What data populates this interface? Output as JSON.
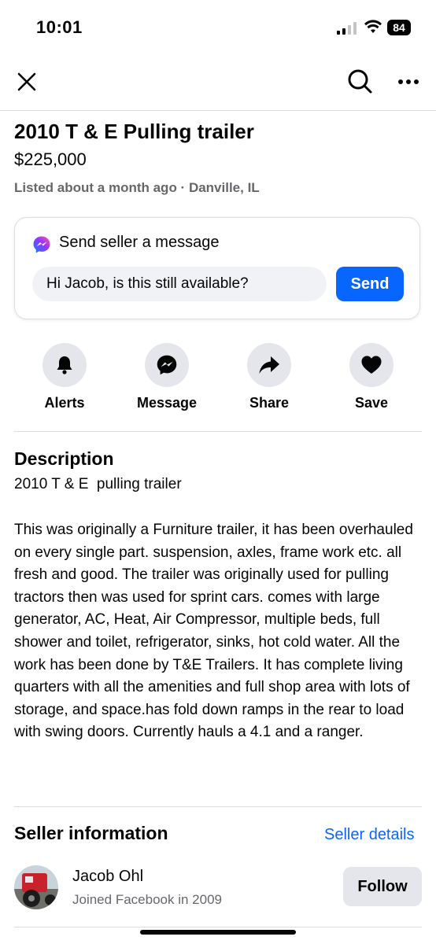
{
  "status_bar": {
    "time": "10:01",
    "battery": "84",
    "icons": [
      "signal-icon",
      "wifi-icon",
      "battery-icon"
    ]
  },
  "nav": {
    "icons": [
      "close-icon",
      "search-icon",
      "more-icon"
    ]
  },
  "listing": {
    "title": "2010 T & E Pulling trailer",
    "price": "$225,000",
    "meta": "Listed about a month ago · Danville, IL"
  },
  "message_card": {
    "heading": "Send seller a message",
    "input_value": "Hi Jacob, is this still available?",
    "send_label": "Send",
    "icon": "messenger-icon"
  },
  "actions": [
    {
      "label": "Alerts",
      "icon": "bell-icon"
    },
    {
      "label": "Message",
      "icon": "messenger-icon"
    },
    {
      "label": "Share",
      "icon": "share-icon"
    },
    {
      "label": "Save",
      "icon": "heart-icon"
    }
  ],
  "description": {
    "heading": "Description",
    "subtitle": "2010 T & E  pulling trailer",
    "body": "This was originally a Furniture trailer, it has been overhauled on every single part. suspension, axles, frame work etc. all fresh and good. The trailer was originally used for pulling tractors then was used for sprint cars. comes with large generator, AC, Heat, Air Compressor, multiple beds, full shower and toilet, refrigerator, sinks, hot cold water. All the work has been done by T&E Trailers. It has complete living quarters with all the amenities and full shop area with lots of storage, and space.has fold down ramps in the rear to load with swing doors. Currently hauls a 4.1 and a ranger."
  },
  "seller": {
    "heading": "Seller information",
    "details_link": "Seller details",
    "name": "Jacob Ohl",
    "joined": "Joined Facebook in 2009",
    "follow_label": "Follow"
  },
  "colors": {
    "accent": "#0866ff",
    "secondary_text": "#65676b",
    "button_bg": "#e4e6eb",
    "input_bg": "#f0f2f5"
  }
}
